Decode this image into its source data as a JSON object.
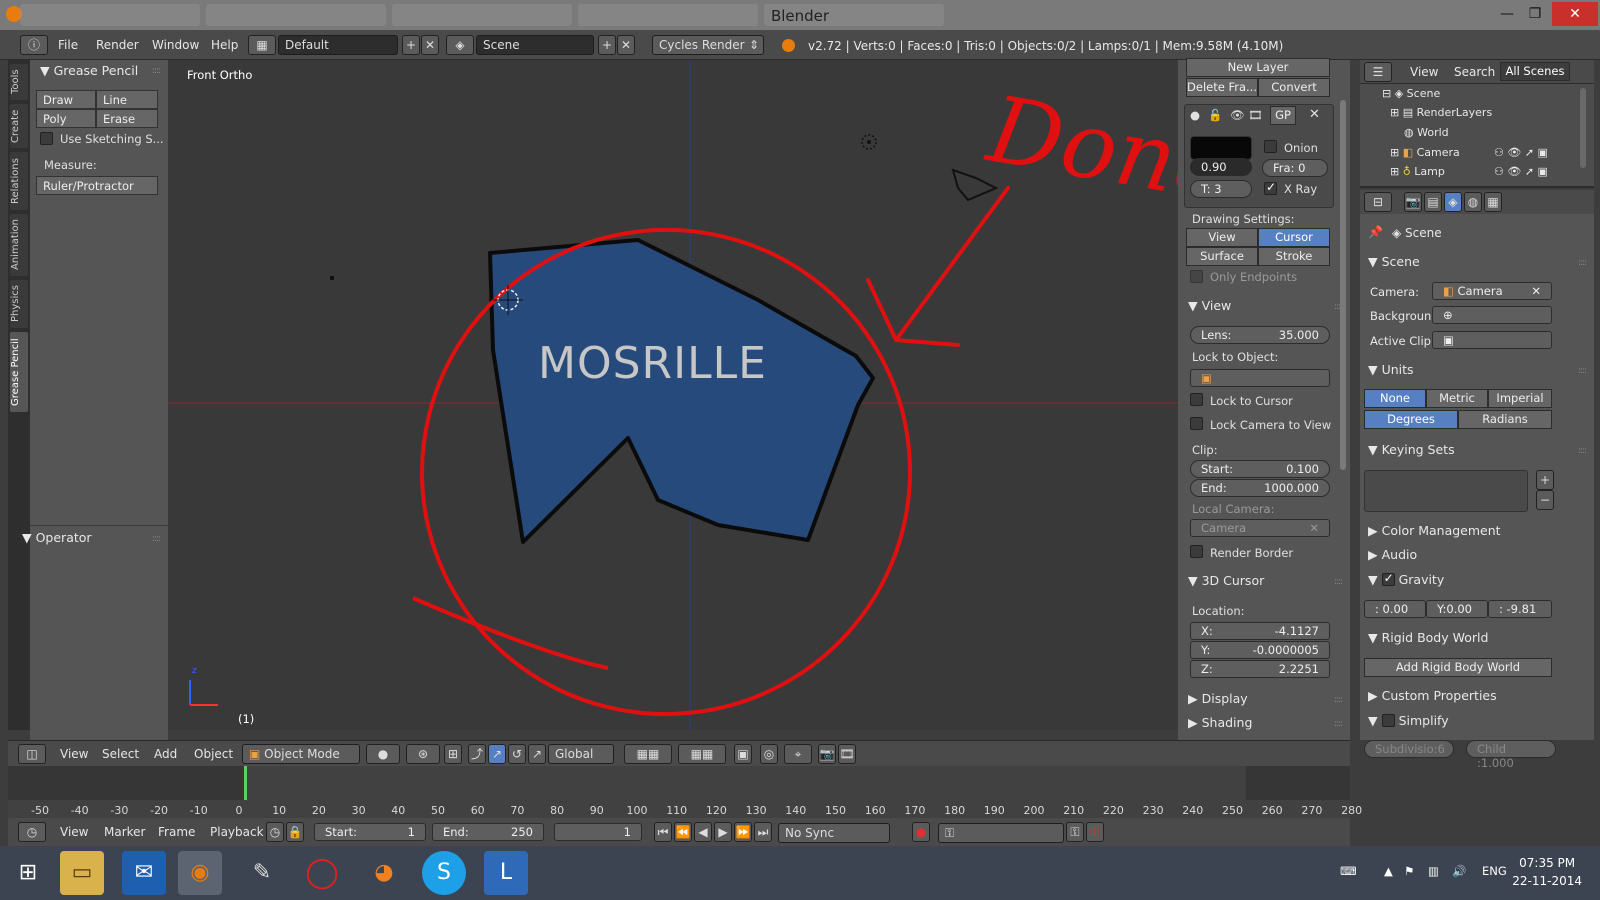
{
  "window": {
    "title": "Blender"
  },
  "info_header": {
    "menus": [
      "File",
      "Render",
      "Window",
      "Help"
    ],
    "layout": "Default",
    "scene": "Scene",
    "engine": "Cycles Render",
    "stats": "v2.72 | Verts:0 | Faces:0 | Tris:0 | Objects:0/2 | Lamps:0/1 | Mem:9.58M (4.10M)"
  },
  "left_tabs": [
    "Tools",
    "Create",
    "Relations",
    "Animation",
    "Physics",
    "Grease Pencil"
  ],
  "tool_shelf": {
    "panel_title": "Grease Pencil",
    "draw": "Draw",
    "line": "Line",
    "poly": "Poly",
    "erase": "Erase",
    "use_sketching": "Use Sketching S...",
    "measure": "Measure:",
    "ruler": "Ruler/Protractor",
    "operator": "Operator"
  },
  "viewport": {
    "view_name": "Front Ortho",
    "frame_indicator": "(1)",
    "logo_text": "MOSRILLE",
    "annotation": "Done",
    "axis_label": "z"
  },
  "n_panel": {
    "new_layer": "New Layer",
    "delete_frame": "Delete Fra...",
    "convert": "Convert",
    "gp": "GP",
    "onion": "Onion",
    "fra": "Fra: 0",
    "opacity": "0.90",
    "thickness": "T: 3",
    "xray": "X Ray",
    "drawing_settings": "Drawing Settings:",
    "view_btn": "View",
    "cursor_btn": "Cursor",
    "surface_btn": "Surface",
    "stroke_btn": "Stroke",
    "only_endpoints": "Only Endpoints",
    "view_panel": "View",
    "lens_label": "Lens:",
    "lens_value": "35.000",
    "lock_to_object": "Lock to Object:",
    "lock_to_cursor": "Lock to Cursor",
    "lock_camera": "Lock Camera to View",
    "clip": "Clip:",
    "clip_start_label": "Start:",
    "clip_start": "0.100",
    "clip_end_label": "End:",
    "clip_end": "1000.000",
    "local_camera": "Local Camera:",
    "camera": "Camera",
    "render_border": "Render Border",
    "cursor_panel": "3D Cursor",
    "location": "Location:",
    "x_label": "X:",
    "x": "-4.1127",
    "y_label": "Y:",
    "y": "-0.0000005",
    "z_label": "Z:",
    "z": "2.2251",
    "display": "Display",
    "shading": "Shading"
  },
  "outliner": {
    "view": "View",
    "search": "Search",
    "filter": "All Scenes",
    "items": [
      "Scene",
      "RenderLayers",
      "World",
      "Camera",
      "Lamp"
    ]
  },
  "properties": {
    "context": "Scene",
    "scene_panel": "Scene",
    "camera_label": "Camera:",
    "camera_value": "Camera",
    "background": "Backgroun",
    "active_clip": "Active Clip",
    "units_panel": "Units",
    "none": "None",
    "metric": "Metric",
    "imperial": "Imperial",
    "degrees": "Degrees",
    "radians": "Radians",
    "keying_sets": "Keying Sets",
    "color_management": "Color Management",
    "audio": "Audio",
    "gravity": "Gravity",
    "gx": ": 0.00",
    "gy": "Y:0.00",
    "gz": ": -9.81",
    "rigid_body": "Rigid Body World",
    "add_rigid": "Add Rigid Body World",
    "custom_props": "Custom Properties",
    "simplify": "Simplify",
    "subdivision": "Subdivisio:6",
    "child": "Child :1.000"
  },
  "viewport_header": {
    "menus": [
      "View",
      "Select",
      "Add",
      "Object"
    ],
    "mode": "Object Mode",
    "orientation": "Global"
  },
  "timeline": {
    "ticks": [
      "-50",
      "-40",
      "-30",
      "-20",
      "-10",
      "0",
      "10",
      "20",
      "30",
      "40",
      "50",
      "60",
      "70",
      "80",
      "90",
      "100",
      "110",
      "120",
      "130",
      "140",
      "150",
      "160",
      "170",
      "180",
      "190",
      "200",
      "210",
      "220",
      "230",
      "240",
      "250",
      "260",
      "270",
      "280"
    ],
    "menus": [
      "View",
      "Marker",
      "Frame",
      "Playback"
    ],
    "start": "Start:",
    "start_value": "1",
    "end": "End:",
    "end_value": "250",
    "current": "1",
    "sync": "No Sync"
  },
  "taskbar": {
    "lang": "ENG",
    "time": "07:35 PM",
    "date": "22-11-2014"
  }
}
